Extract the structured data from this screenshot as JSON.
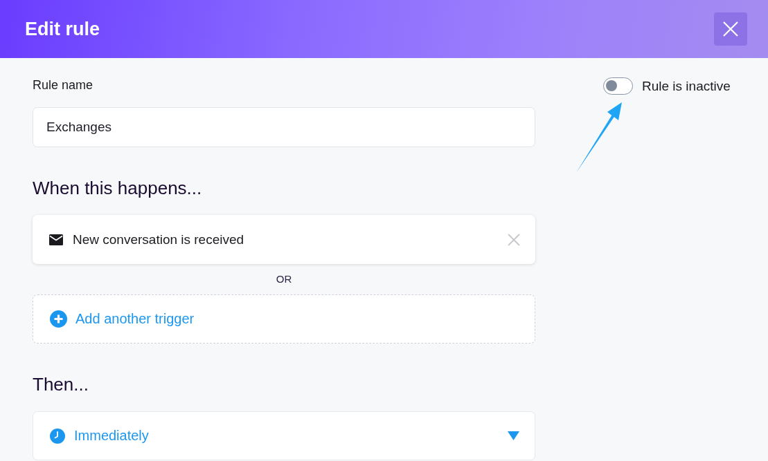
{
  "header": {
    "title": "Edit rule"
  },
  "rule_name": {
    "label": "Rule name",
    "value": "Exchanges"
  },
  "status": {
    "on": false,
    "label": "Rule is inactive"
  },
  "trigger_section": {
    "heading": "When this happens...",
    "triggers": [
      {
        "label": "New conversation is received"
      }
    ],
    "separator": "OR",
    "add_button": "Add another trigger"
  },
  "action_section": {
    "heading": "Then...",
    "timing": {
      "value": "Immediately"
    }
  }
}
